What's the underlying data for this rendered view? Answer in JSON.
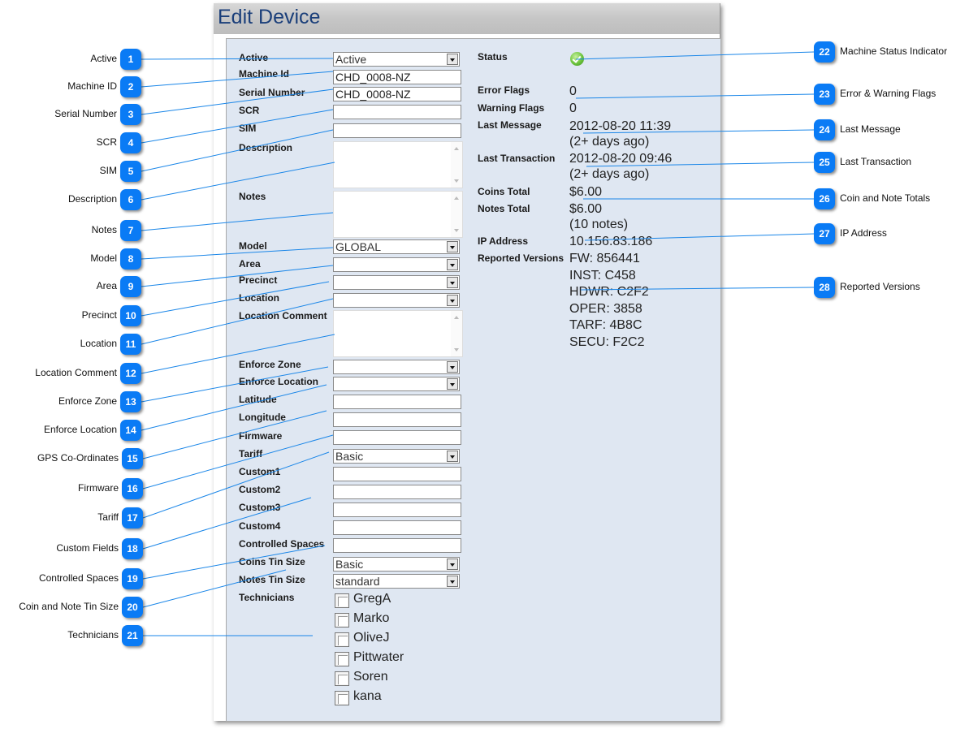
{
  "window": {
    "title": "Edit Device"
  },
  "form": {
    "fields": [
      {
        "key": "active",
        "label": "Active",
        "type": "select",
        "value": "Active"
      },
      {
        "key": "machine_id",
        "label": "Machine Id",
        "type": "text",
        "value": "CHD_0008-NZ"
      },
      {
        "key": "serial_number",
        "label": "Serial Number",
        "type": "text",
        "value": "CHD_0008-NZ"
      },
      {
        "key": "scr",
        "label": "SCR",
        "type": "text",
        "value": ""
      },
      {
        "key": "sim",
        "label": "SIM",
        "type": "text",
        "value": ""
      },
      {
        "key": "description",
        "label": "Description",
        "type": "textarea",
        "value": ""
      },
      {
        "key": "notes",
        "label": "Notes",
        "type": "textarea",
        "value": ""
      },
      {
        "key": "model",
        "label": "Model",
        "type": "select",
        "value": "GLOBAL"
      },
      {
        "key": "area",
        "label": "Area",
        "type": "select",
        "value": ""
      },
      {
        "key": "precinct",
        "label": "Precinct",
        "type": "select",
        "value": ""
      },
      {
        "key": "location",
        "label": "Location",
        "type": "select",
        "value": ""
      },
      {
        "key": "location_comment",
        "label": "Location Comment",
        "type": "textarea",
        "value": ""
      },
      {
        "key": "enforce_zone",
        "label": "Enforce Zone",
        "type": "select",
        "value": ""
      },
      {
        "key": "enforce_location",
        "label": "Enforce Location",
        "type": "select",
        "value": ""
      },
      {
        "key": "latitude",
        "label": "Latitude",
        "type": "text",
        "value": ""
      },
      {
        "key": "longitude",
        "label": "Longitude",
        "type": "text",
        "value": ""
      },
      {
        "key": "firmware",
        "label": "Firmware",
        "type": "text",
        "value": ""
      },
      {
        "key": "tariff",
        "label": "Tariff",
        "type": "select",
        "value": "Basic"
      },
      {
        "key": "custom1",
        "label": "Custom1",
        "type": "text",
        "value": ""
      },
      {
        "key": "custom2",
        "label": "Custom2",
        "type": "text",
        "value": ""
      },
      {
        "key": "custom3",
        "label": "Custom3",
        "type": "text",
        "value": ""
      },
      {
        "key": "custom4",
        "label": "Custom4",
        "type": "text",
        "value": ""
      },
      {
        "key": "controlled_spaces",
        "label": "Controlled Spaces",
        "type": "text",
        "value": ""
      },
      {
        "key": "coins_tin_size",
        "label": "Coins Tin Size",
        "type": "select",
        "value": "Basic"
      },
      {
        "key": "notes_tin_size",
        "label": "Notes Tin Size",
        "type": "select",
        "value": "standard"
      }
    ],
    "technicians_label": "Technicians",
    "technicians": [
      {
        "name": "GregA",
        "checked": false
      },
      {
        "name": "Marko",
        "checked": false
      },
      {
        "name": "OliveJ",
        "checked": false
      },
      {
        "name": "Pittwater",
        "checked": false
      },
      {
        "name": "Soren",
        "checked": false
      },
      {
        "name": "kana",
        "checked": false
      }
    ]
  },
  "status_panel": {
    "status_label": "Status",
    "status_icon": "green-check-icon",
    "status_color": "#6cc43c",
    "error_flags_label": "Error Flags",
    "error_flags": "0",
    "warning_flags_label": "Warning Flags",
    "warning_flags": "0",
    "last_message_label": "Last Message",
    "last_message": "2012-08-20 11:39",
    "last_message_ago": "(2+ days ago)",
    "last_transaction_label": "Last Transaction",
    "last_transaction": "2012-08-20 09:46",
    "last_transaction_ago": "(2+ days ago)",
    "coins_total_label": "Coins Total",
    "coins_total": "$6.00",
    "notes_total_label": "Notes Total",
    "notes_total": "$6.00",
    "notes_count": "(10 notes)",
    "ip_address_label": "IP Address",
    "ip_address": "10.156.83.186",
    "reported_versions_label": "Reported Versions",
    "reported_versions": [
      "FW: 856441",
      "INST: C458",
      "HDWR: C2F2",
      "OPER: 3858",
      "TARF: 4B8C",
      "SECU: F2C2"
    ]
  },
  "callouts": {
    "badge_color": "#0a7bf5",
    "left": [
      {
        "n": "1",
        "label": "Active"
      },
      {
        "n": "2",
        "label": "Machine ID"
      },
      {
        "n": "3",
        "label": "Serial Number"
      },
      {
        "n": "4",
        "label": "SCR"
      },
      {
        "n": "5",
        "label": "SIM"
      },
      {
        "n": "6",
        "label": "Description"
      },
      {
        "n": "7",
        "label": "Notes"
      },
      {
        "n": "8",
        "label": "Model"
      },
      {
        "n": "9",
        "label": "Area"
      },
      {
        "n": "10",
        "label": "Precinct"
      },
      {
        "n": "11",
        "label": "Location"
      },
      {
        "n": "12",
        "label": "Location Comment"
      },
      {
        "n": "13",
        "label": "Enforce Zone"
      },
      {
        "n": "14",
        "label": "Enforce Location"
      },
      {
        "n": "15",
        "label": "GPS Co-Ordinates"
      },
      {
        "n": "16",
        "label": "Firmware"
      },
      {
        "n": "17",
        "label": "Tariff"
      },
      {
        "n": "18",
        "label": "Custom Fields"
      },
      {
        "n": "19",
        "label": "Controlled Spaces"
      },
      {
        "n": "20",
        "label": "Coin and Note Tin Size"
      },
      {
        "n": "21",
        "label": "Technicians"
      }
    ],
    "right": [
      {
        "n": "22",
        "label": "Machine Status Indicator"
      },
      {
        "n": "23",
        "label": "Error & Warning Flags"
      },
      {
        "n": "24",
        "label": "Last Message"
      },
      {
        "n": "25",
        "label": "Last Transaction"
      },
      {
        "n": "26",
        "label": "Coin and Note Totals"
      },
      {
        "n": "27",
        "label": "IP Address"
      },
      {
        "n": "28",
        "label": "Reported Versions"
      }
    ]
  }
}
